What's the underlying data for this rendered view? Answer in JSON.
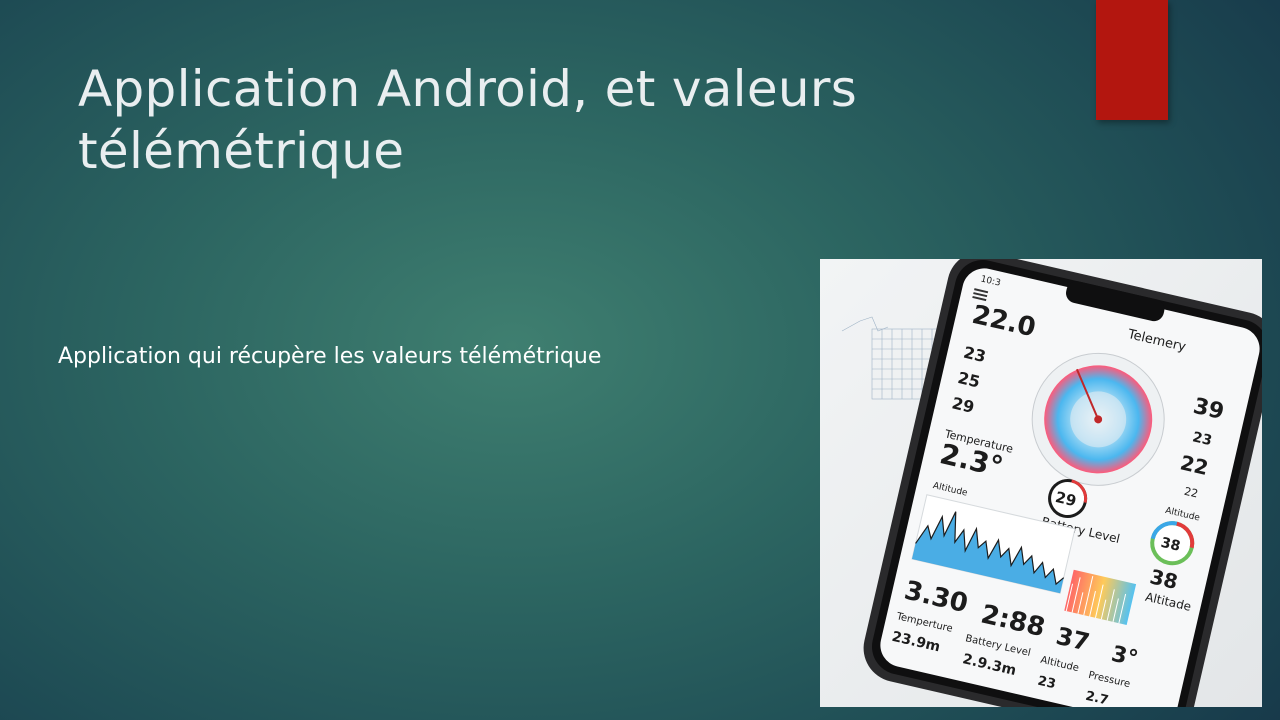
{
  "slide": {
    "title": "Application Android, et valeurs télémétrique",
    "body": "Application qui récupère les valeurs télémétrique",
    "accent_color": "#b3160f"
  },
  "phone_image": {
    "time": "10:3",
    "header": "Telemery",
    "top_left_value": "22.0",
    "left_values": [
      "23",
      "25",
      "29"
    ],
    "right_values": [
      "39",
      "23",
      "22",
      "22"
    ],
    "temperature_label": "Temperature",
    "temperature_value": "2.3°",
    "battery_ring_value": "29",
    "battery_label": "Battery Level",
    "ring_right_value": "38",
    "right_big_value": "38",
    "altitude_label": "Altitade",
    "altitude_small_label": "Altitude",
    "graph_label": "Altitude",
    "bottom_values": [
      "3.30",
      "2:88",
      "37",
      "3°"
    ],
    "bottom_labels": [
      "Temperture",
      "Battery Level",
      "Altitude",
      "Pressure"
    ],
    "bottom_subvalues": [
      "23.9m",
      "2.9.3m",
      "23",
      "2.7"
    ]
  }
}
